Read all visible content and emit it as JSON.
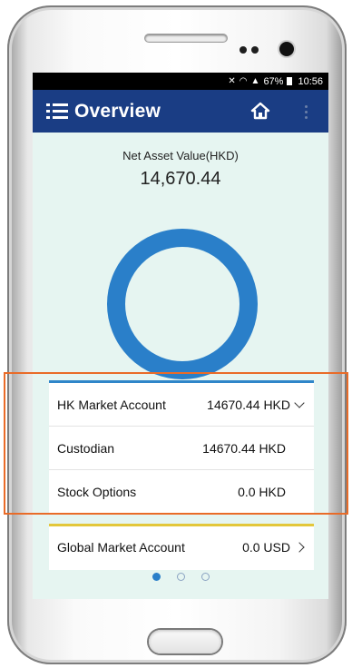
{
  "status_bar": {
    "icons": [
      "mute-icon",
      "wifi-icon",
      "signal-icon",
      "battery-icon"
    ],
    "battery": "67%",
    "time": "10:56"
  },
  "app_bar": {
    "title": "Overview",
    "menu_icon": "hamburger-menu-icon",
    "home_icon": "home-icon",
    "overflow_icon": "more-vert-icon"
  },
  "summary": {
    "label": "Net Asset Value(HKD)",
    "value": "14,670.44"
  },
  "donut_chart": {
    "color": "#2a7fc9"
  },
  "accounts": [
    {
      "name": "HK Market Account",
      "value": "14670.44 HKD",
      "indicator": "chevron-down-icon"
    },
    {
      "name": "Custodian",
      "value": "14670.44 HKD"
    },
    {
      "name": "Stock Options",
      "value": "0.0 HKD"
    }
  ],
  "global_account": {
    "name": "Global Market Account",
    "value": "0.0 USD",
    "indicator": "chevron-right-icon"
  },
  "pager": {
    "count": 3,
    "active": 0
  },
  "colors": {
    "app_bar": "#1a3d84",
    "accent": "#2a7fc9",
    "background": "#e6f5f1",
    "global_card_accent": "#e3c73a",
    "highlight": "#e96b28"
  }
}
